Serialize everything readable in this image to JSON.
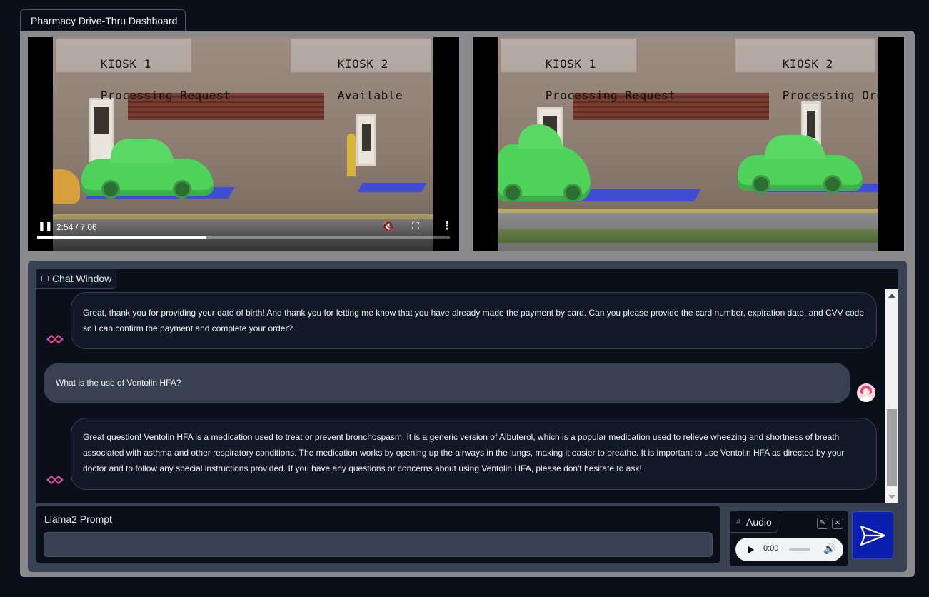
{
  "tabs": [
    {
      "label": "Pharmacy Drive-Thru Dashboard"
    }
  ],
  "videos": [
    {
      "kiosk1": {
        "name": "KIOSK 1",
        "status": "Processing Request"
      },
      "kiosk2": {
        "name": "KIOSK 2",
        "status": "Available"
      },
      "controls": {
        "time": "2:54 / 7:06",
        "progress": 0.41
      }
    },
    {
      "kiosk1": {
        "name": "KIOSK 1",
        "status": "Processing Request"
      },
      "kiosk2": {
        "name": "KIOSK 2",
        "status": "Processing Order"
      }
    }
  ],
  "chat": {
    "label": "Chat Window",
    "messages": [
      {
        "role": "bot",
        "text": "Great, thank you for providing your date of birth! And thank you for letting me know that you have already made the payment by card. Can you please provide the card number, expiration date, and CVV code so I can confirm the payment and complete your order?"
      },
      {
        "role": "user",
        "text": "What is the use of Ventolin HFA?"
      },
      {
        "role": "bot",
        "text": "Great question! Ventolin HFA is a medication used to treat or prevent bronchospasm. It is a generic version of Albuterol, which is a popular medication used to relieve wheezing and shortness of breath associated with asthma and other respiratory conditions. The medication works by opening up the airways in the lungs, making it easier to breathe. It is important to use Ventolin HFA as directed by your doctor and to follow any special instructions provided. If you have any questions or concerns about using Ventolin HFA, please don't hesitate to ask!"
      }
    ]
  },
  "prompt": {
    "label": "Llama2 Prompt",
    "value": "",
    "placeholder": ""
  },
  "audio": {
    "label": "Audio",
    "time": "0:00"
  },
  "icons": {
    "chat_label": "chat-bubble-icon",
    "bot_avatar": "bot-logo-icon",
    "user_avatar": "user-avatar-icon",
    "audio_label": "music-note-icon",
    "edit": "pencil-icon",
    "clear": "close-icon",
    "send": "send-arrow-icon",
    "pause": "pause-icon",
    "mute": "volume-muted-icon",
    "fullscreen": "fullscreen-icon",
    "more": "more-vertical-icon"
  },
  "colors": {
    "accent": "#0b1fae",
    "detect_car": "#4fd35a",
    "detect_zone": "#3246e6"
  }
}
